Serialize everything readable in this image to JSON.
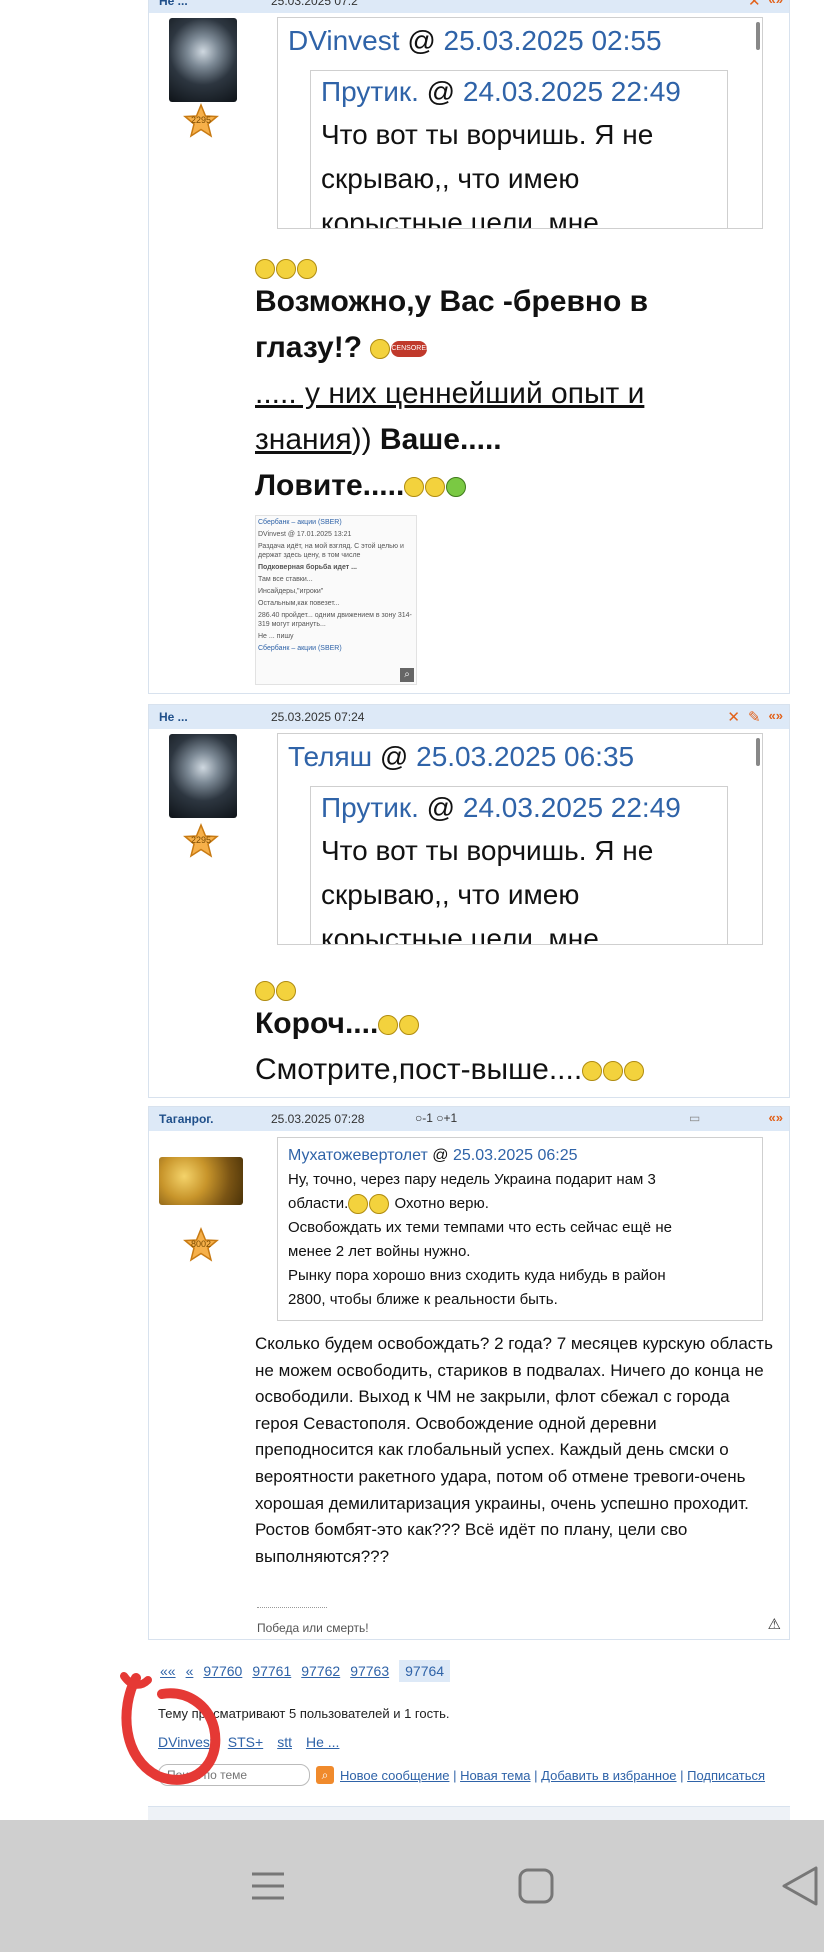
{
  "posts": [
    {
      "author": "Не ...",
      "date": "25.03.2025 07:2",
      "rank": "2295",
      "quote_outer_author": "DVinvest",
      "quote_outer_date": "25.03.2025 02:55",
      "quote_inner_author": "Прутик.",
      "quote_inner_date": "24.03.2025 22:49",
      "quote_inner_text": "Что вот ты ворчишь. Я не скрываю,, что имею корыстные цели, мне",
      "body_line1": "Возможно,у Вас -бревно в",
      "body_line2": "глазу!?",
      "censor_label": "CENSORED",
      "body_line3": "..... у них ценнейший опыт и",
      "body_line4_underlined": "знания",
      "body_line4_rest": ")) ",
      "body_line4_bold": "Ваше.....",
      "body_line5": "Ловите.....",
      "thumb_lines": [
        "Сбербанк – акции (SBER)",
        "DVinvest @ 17.01.2025 13:21",
        "Раздача идёт, на мой взгляд. С этой целью и держат здесь цену, в том числе",
        "Подковерная борьба идет ...",
        "Там все ставки...",
        "Инсайдеры,\"игроки\"",
        "Остальным,как повезет...",
        "286.40 пройдет... одним движением в зону 314-319 могут игрануть...",
        "Не ... пишу",
        "Сбербанк – акции (SBER)"
      ]
    },
    {
      "author": "Не ...",
      "date": "25.03.2025 07:24",
      "rank": "2295",
      "quote_outer_author": "Теляш",
      "quote_outer_date": "25.03.2025 06:35",
      "quote_inner_author": "Прутик.",
      "quote_inner_date": "24.03.2025 22:49",
      "quote_inner_text": "Что вот ты ворчишь. Я не скрываю,, что имею корыстные цели, мне",
      "body_line1": "Короч....",
      "body_line2": "Смотрите,пост-выше...."
    },
    {
      "author": "Таганрог.",
      "date": "25.03.2025 07:28",
      "vote_minus": "-1",
      "vote_plus": "+1",
      "rank": "8002",
      "quote_author": "Мухатожевертолет",
      "quote_date": "25.03.2025 06:25",
      "quote_lines": [
        "Ну, точно, через пару недель Украина подарит нам 3",
        "области.",
        " Охотно верю.",
        "Освобождать их теми темпами что есть сейчас ещё не",
        "менее 2 лет войны нужно.",
        "Рынку пора хорошо вниз сходить куда нибудь в район",
        "2800, чтобы ближе к реальности быть."
      ],
      "body": "Сколько будем освобождать? 2 года? 7 месяцев курскую область не можем освободить, стариков в подвалах. Ничего до конца не освободили. Выход к ЧМ не закрыли, флот сбежал с города героя Севастополя. Освобождение одной деревни преподносится как глобальный успех. Каждый день смски о вероятности ракетного удара, потом об отмене тревоги-очень хорошая демилитаризация украины, очень успешно проходит. Ростов бомбят-это как??? Всё идёт по плану, цели сво выполняются???",
      "signature": "Победа или смерть!"
    }
  ],
  "pager": {
    "first": "««",
    "prev": "«",
    "pages": [
      "97760",
      "97761",
      "97762",
      "97763"
    ],
    "current": "97764"
  },
  "viewers_text": "Тему просматривают 5 пользователей и 1 гость.",
  "viewers": [
    "DVinvest",
    "STS+",
    "stt",
    "Не ..."
  ],
  "search_placeholder": "Поиск по теме",
  "links": [
    "Новое сообщение",
    "Новая тема",
    "Добавить в избранное",
    "Подписаться"
  ],
  "colors": {
    "header_bg": "#dde9f7",
    "link": "#2f63a8",
    "accent": "#e2621b",
    "navbar": "#cfcfcf",
    "red_mark": "#e53935"
  }
}
